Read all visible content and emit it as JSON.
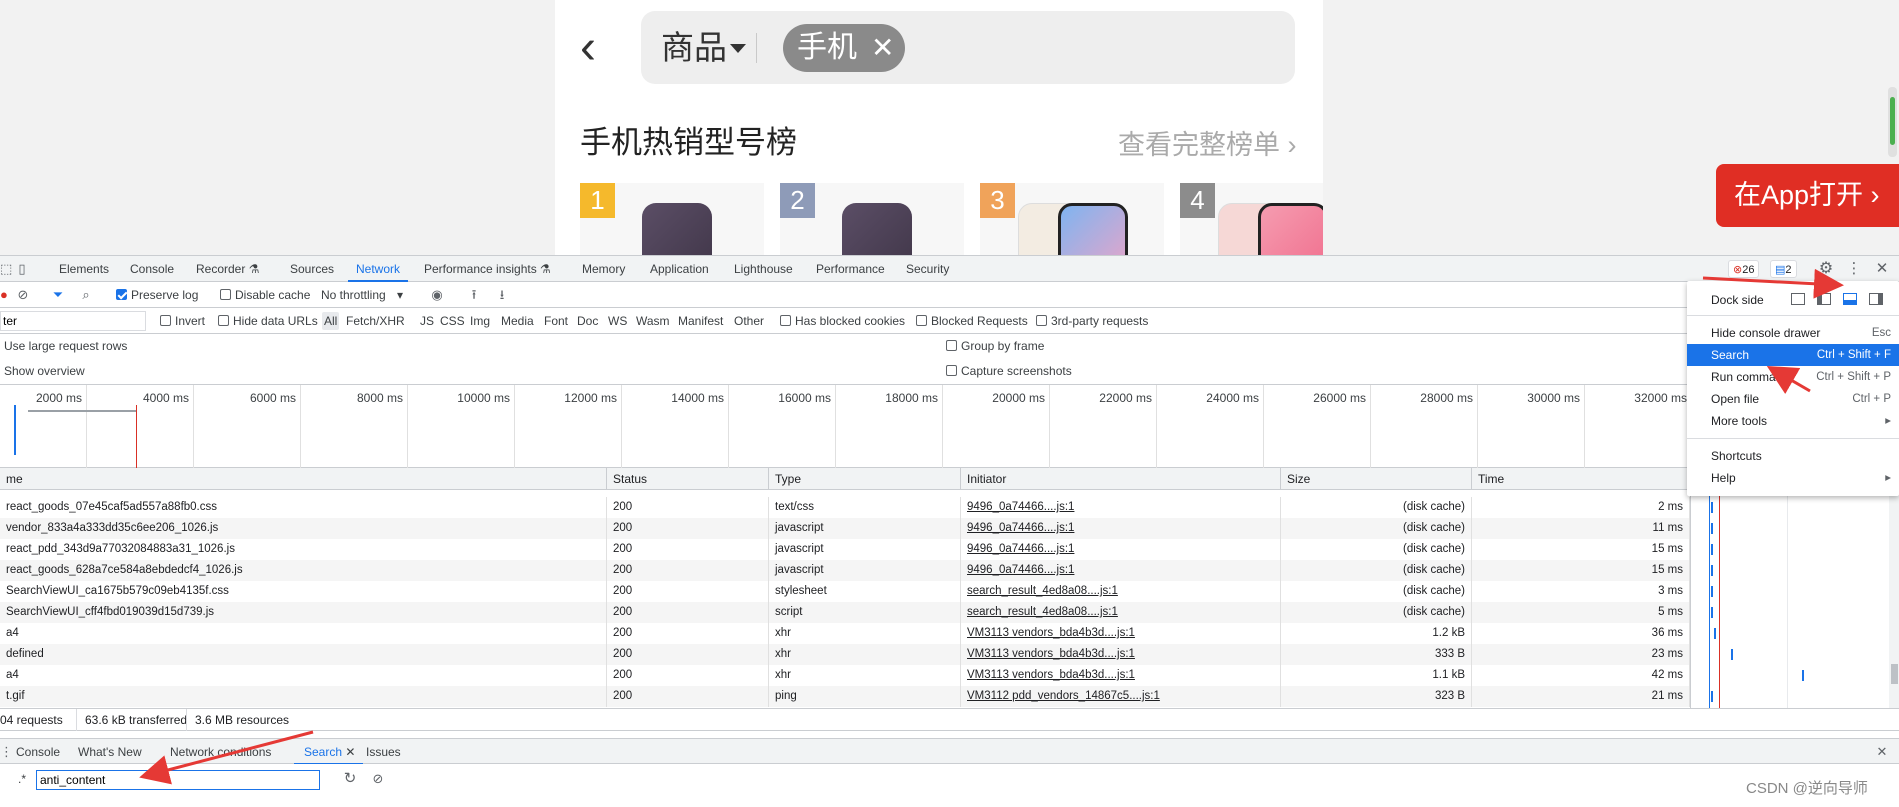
{
  "mobile": {
    "search_category": "商品",
    "search_tag": "手机",
    "rank_title": "手机热销型号榜",
    "rank_more": "查看完整榜单",
    "cards": [
      {
        "rank": "1",
        "badge_color": "#f5b92c"
      },
      {
        "rank": "2",
        "badge_color": "#8e9bb8"
      },
      {
        "rank": "3",
        "badge_color": "#f0a35a"
      },
      {
        "rank": "4",
        "badge_color": "#8c8c8c"
      }
    ],
    "open_app": "在App打开"
  },
  "devtools": {
    "tabs": [
      "Elements",
      "Console",
      "Recorder ⚗",
      "Sources",
      "Network",
      "Performance insights ⚗",
      "Memory",
      "Application",
      "Lighthouse",
      "Performance",
      "Security"
    ],
    "active_tab": "Network",
    "errors_count": "26",
    "messages_count": "2",
    "toolbar": {
      "preserve_log": "Preserve log",
      "disable_cache": "Disable cache",
      "throttling": "No throttling"
    },
    "filter": {
      "placeholder": "Filter",
      "value": "ter",
      "invert": "Invert",
      "hide_data_urls": "Hide data URLs",
      "types": [
        "All",
        "Fetch/XHR",
        "JS",
        "CSS",
        "Img",
        "Media",
        "Font",
        "Doc",
        "WS",
        "Wasm",
        "Manifest",
        "Other"
      ],
      "has_blocked_cookies": "Has blocked cookies",
      "blocked_requests": "Blocked Requests",
      "third_party": "3rd-party requests"
    },
    "settings": {
      "large_rows": "Use large request rows",
      "show_overview": "Show overview",
      "group_by_frame": "Group by frame",
      "capture_screenshots": "Capture screenshots"
    },
    "timeline_ticks": [
      "2000 ms",
      "4000 ms",
      "6000 ms",
      "8000 ms",
      "10000 ms",
      "12000 ms",
      "14000 ms",
      "16000 ms",
      "18000 ms",
      "20000 ms",
      "22000 ms",
      "24000 ms",
      "26000 ms",
      "28000 ms",
      "30000 ms",
      "32000 ms"
    ],
    "columns": [
      "me",
      "Status",
      "Type",
      "Initiator",
      "Size",
      "Time"
    ],
    "rows": [
      {
        "name": "react_goods_07e45caf5ad557a88fb0.css",
        "status": "200",
        "type": "text/css",
        "initiator": "9496_0a74466....js:1",
        "size": "(disk cache)",
        "time": "2 ms"
      },
      {
        "name": "vendor_833a4a333dd35c6ee206_1026.js",
        "status": "200",
        "type": "javascript",
        "initiator": "9496_0a74466....js:1",
        "size": "(disk cache)",
        "time": "11 ms"
      },
      {
        "name": "react_pdd_343d9a77032084883a31_1026.js",
        "status": "200",
        "type": "javascript",
        "initiator": "9496_0a74466....js:1",
        "size": "(disk cache)",
        "time": "15 ms"
      },
      {
        "name": "react_goods_628a7ce584a8ebdedcf4_1026.js",
        "status": "200",
        "type": "javascript",
        "initiator": "9496_0a74466....js:1",
        "size": "(disk cache)",
        "time": "15 ms"
      },
      {
        "name": "SearchViewUI_ca1675b579c09eb4135f.css",
        "status": "200",
        "type": "stylesheet",
        "initiator": "search_result_4ed8a08....js:1",
        "size": "(disk cache)",
        "time": "3 ms"
      },
      {
        "name": "SearchViewUI_cff4fbd019039d15d739.js",
        "status": "200",
        "type": "script",
        "initiator": "search_result_4ed8a08....js:1",
        "size": "(disk cache)",
        "time": "5 ms"
      },
      {
        "name": "a4",
        "status": "200",
        "type": "xhr",
        "initiator": "VM3113 vendors_bda4b3d....js:1",
        "size": "1.2 kB",
        "time": "36 ms"
      },
      {
        "name": "defined",
        "status": "200",
        "type": "xhr",
        "initiator": "VM3113 vendors_bda4b3d....js:1",
        "size": "333 B",
        "time": "23 ms"
      },
      {
        "name": "a4",
        "status": "200",
        "type": "xhr",
        "initiator": "VM3113 vendors_bda4b3d....js:1",
        "size": "1.1 kB",
        "time": "42 ms"
      },
      {
        "name": "t.gif",
        "status": "200",
        "type": "ping",
        "initiator": "VM3112 pdd_vendors_14867c5....js:1",
        "size": "323 B",
        "time": "21 ms"
      }
    ],
    "summary": {
      "requests": "04 requests",
      "transferred": "63.6 kB transferred",
      "resources": "3.6 MB resources"
    },
    "drawer_tabs": [
      "Console",
      "What's New",
      "Network conditions",
      "Search",
      "Issues"
    ],
    "drawer_active": "Search",
    "search_query": "anti_content",
    "regex_label": ".*"
  },
  "menu": {
    "dock_side": "Dock side",
    "items": [
      {
        "label": "Hide console drawer",
        "shortcut": "Esc"
      },
      {
        "label": "Search",
        "shortcut": "Ctrl + Shift + F"
      },
      {
        "label": "Run command",
        "shortcut": "Ctrl + Shift + P"
      },
      {
        "label": "Open file",
        "shortcut": "Ctrl + P"
      },
      {
        "label": "More tools",
        "shortcut": "▸"
      }
    ],
    "items2": [
      {
        "label": "Shortcuts",
        "shortcut": ""
      },
      {
        "label": "Help",
        "shortcut": "▸"
      }
    ]
  },
  "watermark": "CSDN @逆向导师",
  "accent": "#1a73e8",
  "arrow_color": "#e53935"
}
